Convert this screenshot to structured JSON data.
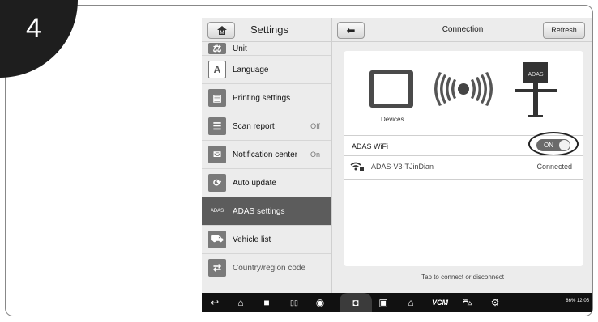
{
  "step_number": "4",
  "sidebar": {
    "header_title": "Settings",
    "items": [
      {
        "label": "Unit",
        "value": "",
        "icon": "scale-icon"
      },
      {
        "label": "Language",
        "value": "",
        "icon": "language-icon",
        "icon_text": "A"
      },
      {
        "label": "Printing settings",
        "value": "",
        "icon": "printer-icon"
      },
      {
        "label": "Scan report",
        "value": "Off",
        "icon": "report-icon"
      },
      {
        "label": "Notification center",
        "value": "On",
        "icon": "notification-icon"
      },
      {
        "label": "Auto update",
        "value": "",
        "icon": "update-icon"
      },
      {
        "label": "ADAS settings",
        "value": "",
        "icon": "adas-icon",
        "icon_text": "ADAS",
        "active": true
      },
      {
        "label": "Vehicle list",
        "value": "",
        "icon": "vehicle-list-icon"
      },
      {
        "label": "Country/region code",
        "value": "",
        "icon": "swap-icon"
      }
    ]
  },
  "main": {
    "title": "Connection",
    "refresh_label": "Refresh",
    "devices_label": "Devices",
    "adas_device_text": "ADAS",
    "wifi_row_label": "ADAS WiFi",
    "toggle_label": "ON",
    "network_name": "ADAS-V3-TJinDian",
    "network_status": "Connected",
    "hint": "Tap to connect or disconnect"
  },
  "navbar": {
    "vcm_label": "VCM",
    "status_text": "86% 12:05"
  },
  "colors": {
    "active_item": "#5c5c5c",
    "panel_bg": "#ececec",
    "navbar_bg": "#111111"
  }
}
